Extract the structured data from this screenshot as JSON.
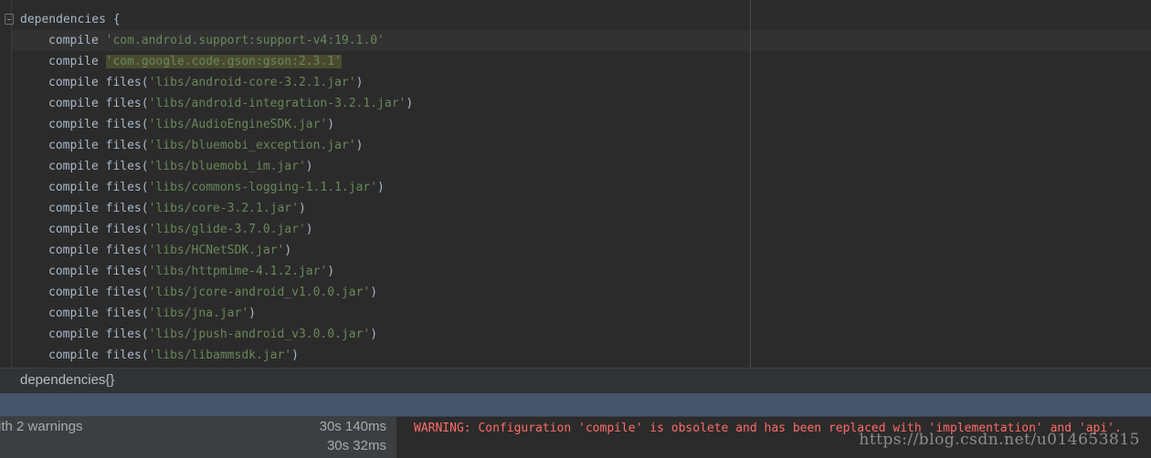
{
  "editor": {
    "lines": [
      {
        "indent": false,
        "keyword": "dependencies",
        "pre": " {",
        "str": "",
        "post": "",
        "highlight": false
      },
      {
        "indent": true,
        "keyword": "compile",
        "pre": " ",
        "str": "'com.android.support:support-v4:19.1.0'",
        "post": "",
        "highlight": false
      },
      {
        "indent": true,
        "keyword": "compile",
        "pre": " ",
        "str": "'com.google.code.gson:gson:2.3.1'",
        "post": "",
        "highlight": true
      },
      {
        "indent": true,
        "keyword": "compile",
        "pre": " files(",
        "str": "'libs/android-core-3.2.1.jar'",
        "post": ")",
        "highlight": false
      },
      {
        "indent": true,
        "keyword": "compile",
        "pre": " files(",
        "str": "'libs/android-integration-3.2.1.jar'",
        "post": ")",
        "highlight": false
      },
      {
        "indent": true,
        "keyword": "compile",
        "pre": " files(",
        "str": "'libs/AudioEngineSDK.jar'",
        "post": ")",
        "highlight": false
      },
      {
        "indent": true,
        "keyword": "compile",
        "pre": " files(",
        "str": "'libs/bluemobi_exception.jar'",
        "post": ")",
        "highlight": false
      },
      {
        "indent": true,
        "keyword": "compile",
        "pre": " files(",
        "str": "'libs/bluemobi_im.jar'",
        "post": ")",
        "highlight": false
      },
      {
        "indent": true,
        "keyword": "compile",
        "pre": " files(",
        "str": "'libs/commons-logging-1.1.1.jar'",
        "post": ")",
        "highlight": false
      },
      {
        "indent": true,
        "keyword": "compile",
        "pre": " files(",
        "str": "'libs/core-3.2.1.jar'",
        "post": ")",
        "highlight": false
      },
      {
        "indent": true,
        "keyword": "compile",
        "pre": " files(",
        "str": "'libs/glide-3.7.0.jar'",
        "post": ")",
        "highlight": false
      },
      {
        "indent": true,
        "keyword": "compile",
        "pre": " files(",
        "str": "'libs/HCNetSDK.jar'",
        "post": ")",
        "highlight": false
      },
      {
        "indent": true,
        "keyword": "compile",
        "pre": " files(",
        "str": "'libs/httpmime-4.1.2.jar'",
        "post": ")",
        "highlight": false
      },
      {
        "indent": true,
        "keyword": "compile",
        "pre": " files(",
        "str": "'libs/jcore-android_v1.0.0.jar'",
        "post": ")",
        "highlight": false
      },
      {
        "indent": true,
        "keyword": "compile",
        "pre": " files(",
        "str": "'libs/jna.jar'",
        "post": ")",
        "highlight": false
      },
      {
        "indent": true,
        "keyword": "compile",
        "pre": " files(",
        "str": "'libs/jpush-android_v3.0.0.jar'",
        "post": ")",
        "highlight": false
      },
      {
        "indent": true,
        "keyword": "compile",
        "pre": " files(",
        "str": "'libs/libammsdk.jar'",
        "post": ")",
        "highlight": false
      }
    ]
  },
  "breadcrumb": {
    "label": "dependencies{}"
  },
  "build": {
    "rows": [
      {
        "label": "ith 2 warnings",
        "time": "30s 140ms"
      },
      {
        "label": "",
        "time": "30s 32ms"
      }
    ],
    "warning": "WARNING: Configuration 'compile' is obsolete and has been replaced with 'implementation' and 'api'.",
    "watermark": "https://blog.csdn.net/u014653815"
  },
  "colors": {
    "editor_bg": "#2b2b2b",
    "code_text": "#a9b7c6",
    "string": "#6a8759",
    "warning": "#ff6b68",
    "tool_header": "#47556a"
  }
}
